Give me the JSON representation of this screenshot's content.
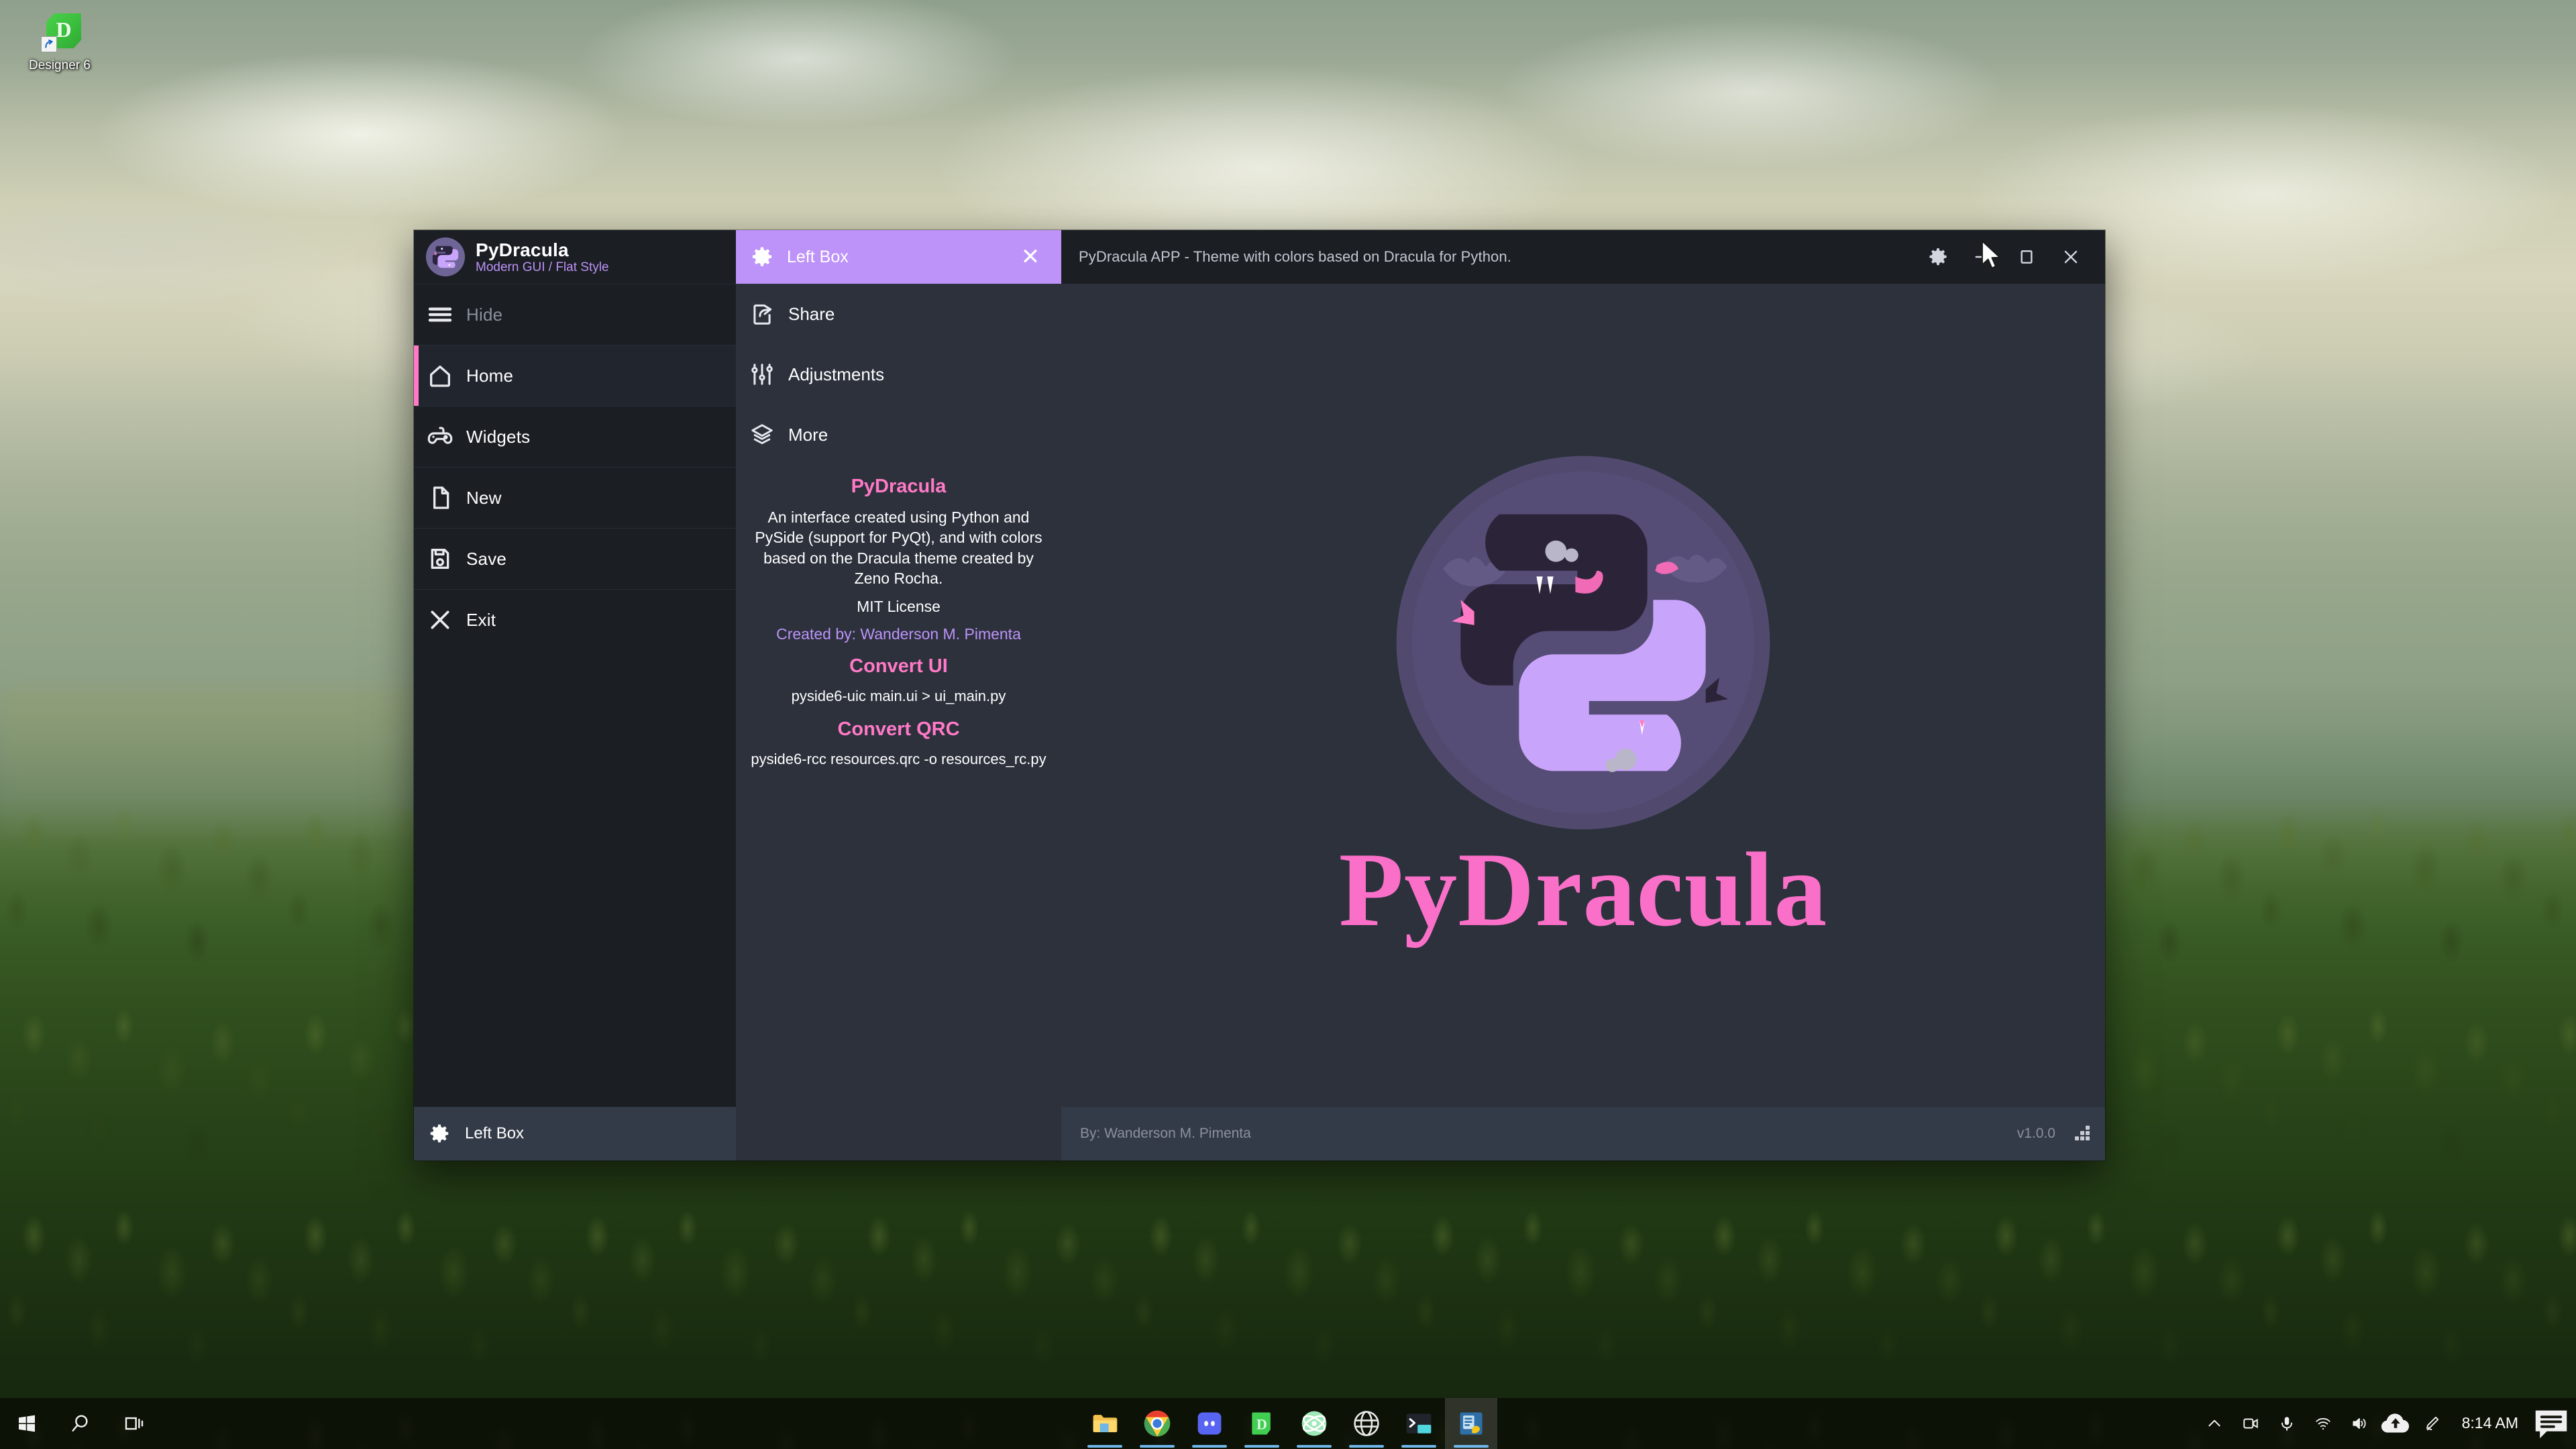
{
  "desktop": {
    "icon": {
      "label": "Designer 6",
      "name": "qt-designer-shortcut"
    }
  },
  "app": {
    "brand": {
      "title": "PyDracula",
      "subtitle": "Modern GUI / Flat Style"
    },
    "colors": {
      "accent_pink": "#ff79c6",
      "accent_purple": "#bd93f9",
      "bg_dark": "#1b1e23",
      "bg_mid": "#2c313c",
      "bg_light": "#343b48"
    },
    "menu": {
      "toggle": {
        "label": "Hide",
        "icon": "hamburger-icon"
      },
      "items": [
        {
          "label": "Home",
          "icon": "home-icon",
          "active": true
        },
        {
          "label": "Widgets",
          "icon": "gamepad-icon",
          "active": false
        },
        {
          "label": "New",
          "icon": "file-icon",
          "active": false
        },
        {
          "label": "Save",
          "icon": "save-icon",
          "active": false
        },
        {
          "label": "Exit",
          "icon": "close-icon",
          "active": false
        }
      ]
    },
    "left_box": {
      "header": {
        "title": "Left Box",
        "gear_icon": "gear-icon",
        "close_label": "✕"
      },
      "items": [
        {
          "label": "Share",
          "icon": "share-icon"
        },
        {
          "label": "Adjustments",
          "icon": "sliders-icon"
        },
        {
          "label": "More",
          "icon": "layers-icon"
        }
      ],
      "info": {
        "heading_1": "PyDracula",
        "description": "An interface created using Python and PySide (support for PyQt), and with colors based on the Dracula theme created by Zeno Rocha.",
        "license": "MIT License",
        "created_by": "Created by: Wanderson M. Pimenta",
        "heading_2": "Convert UI",
        "code_1": "pyside6-uic main.ui > ui_main.py",
        "heading_3": "Convert QRC",
        "code_2": "pyside6-rcc resources.qrc -o resources_rc.py"
      }
    },
    "topbar": {
      "title": "PyDracula APP - Theme with colors based on Dracula for Python.",
      "buttons": [
        {
          "name": "settings-button",
          "icon": "gear-icon"
        },
        {
          "name": "minimize-button",
          "icon": "minimize-icon"
        },
        {
          "name": "maximize-button",
          "icon": "maximize-icon"
        },
        {
          "name": "close-button",
          "icon": "close-icon"
        }
      ]
    },
    "content": {
      "logo_alt": "pydracula-logo",
      "title": "PyDracula"
    },
    "statusbar": {
      "left_label": "Left Box",
      "left_icon": "gear-icon",
      "credits": "By: Wanderson M. Pimenta",
      "version": "v1.0.0",
      "grip_icon": "resize-grip-icon"
    }
  },
  "taskbar": {
    "start": "start-icon",
    "search": "search-icon",
    "taskview": "task-view-icon",
    "apps": [
      {
        "name": "file-explorer",
        "icon": "folder-icon",
        "active": false
      },
      {
        "name": "google-chrome",
        "icon": "chrome-icon",
        "active": false
      },
      {
        "name": "discord",
        "icon": "discord-icon",
        "active": false
      },
      {
        "name": "designer",
        "icon": "designer-icon",
        "active": false
      },
      {
        "name": "atom-editor",
        "icon": "atom-icon",
        "active": false
      },
      {
        "name": "browser",
        "icon": "globe-icon",
        "active": false
      },
      {
        "name": "terminal",
        "icon": "terminal-icon",
        "active": false
      },
      {
        "name": "qt-creator",
        "icon": "qt-icon",
        "active": true
      }
    ],
    "tray": [
      {
        "name": "show-hidden-icons",
        "icon": "chevron-up-icon"
      },
      {
        "name": "screen-record",
        "icon": "camera-icon"
      },
      {
        "name": "microphone",
        "icon": "microphone-icon"
      },
      {
        "name": "network",
        "icon": "wifi-icon"
      },
      {
        "name": "volume",
        "icon": "speaker-icon"
      },
      {
        "name": "onedrive",
        "icon": "cloud-icon"
      },
      {
        "name": "pen-menu",
        "icon": "pen-icon"
      }
    ],
    "clock": "8:14 AM",
    "notifications": "notification-icon"
  }
}
